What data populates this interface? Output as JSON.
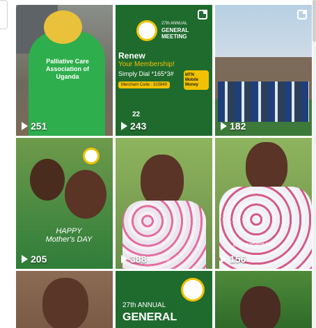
{
  "tiles": [
    {
      "views": "251",
      "label": "tile-1",
      "shirt_text": "Palliative Care Association of Uganda"
    },
    {
      "views": "243",
      "label": "tile-2",
      "headline": "Renew",
      "sub": "Your Membership!",
      "dial": "Simply Dial *165*3#",
      "merchant": "Merchant Code : 315849",
      "event_no": "27th ANNUAL",
      "event_title": "GENERAL MEETING",
      "mtn": "MTN Mobile Money",
      "date": "22"
    },
    {
      "views": "182",
      "label": "tile-3"
    },
    {
      "views": "205",
      "label": "tile-4",
      "caption": "HAPPY Mother's DAY"
    },
    {
      "views": "388",
      "label": "tile-5",
      "subtitle": "preser"
    },
    {
      "views": "156",
      "label": "tile-6",
      "subtitle": "one patient has"
    },
    {
      "views": "",
      "label": "tile-7"
    },
    {
      "views": "",
      "label": "tile-8",
      "event_no": "27th ANNUAL",
      "event_title": "GENERAL"
    },
    {
      "views": "",
      "label": "tile-9"
    }
  ],
  "colors": {
    "green_dark": "#1f6b2e",
    "green": "#2e8b3a",
    "yellow": "#f2c200"
  }
}
